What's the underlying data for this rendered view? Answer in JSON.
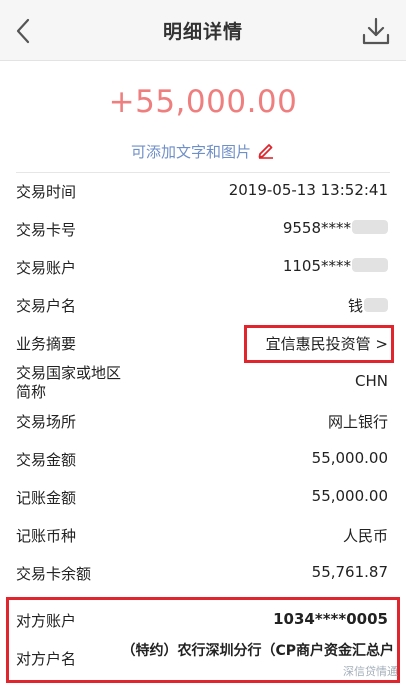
{
  "header": {
    "title": "明细详情",
    "back_icon": "chevron-left-icon",
    "download_icon": "download-icon"
  },
  "amount": "+55,000.00",
  "add_note": "可添加文字和图片",
  "rows": {
    "time": {
      "label": "交易时间",
      "value": "2019-05-13 13:52:41"
    },
    "card": {
      "label": "交易卡号",
      "value": "9558****"
    },
    "account": {
      "label": "交易账户",
      "value": "1105****"
    },
    "name": {
      "label": "交易户名",
      "value": "钱"
    },
    "summary": {
      "label": "业务摘要",
      "value": "宜信惠民投资管 >"
    },
    "country": {
      "label_line1": "交易国家或地区",
      "label_line2": "简称",
      "value": "CHN"
    },
    "place": {
      "label": "交易场所",
      "value": "网上银行"
    },
    "trade_amount": {
      "label": "交易金额",
      "value": "55,000.00"
    },
    "book_amount": {
      "label": "记账金额",
      "value": "55,000.00"
    },
    "currency": {
      "label": "记账币种",
      "value": "人民币"
    },
    "balance": {
      "label": "交易卡余额",
      "value": "55,761.87"
    },
    "counter_account": {
      "label": "对方账户",
      "value": "1034****0005"
    },
    "counter_name": {
      "label": "对方户名",
      "value": "（特约）农行深圳分行（CP商户资金汇总户"
    }
  },
  "watermark": "深信贷情通",
  "colors": {
    "amount": "#ef7f7f",
    "link": "#2a6fd6",
    "highlight_border": "#e0262c"
  }
}
